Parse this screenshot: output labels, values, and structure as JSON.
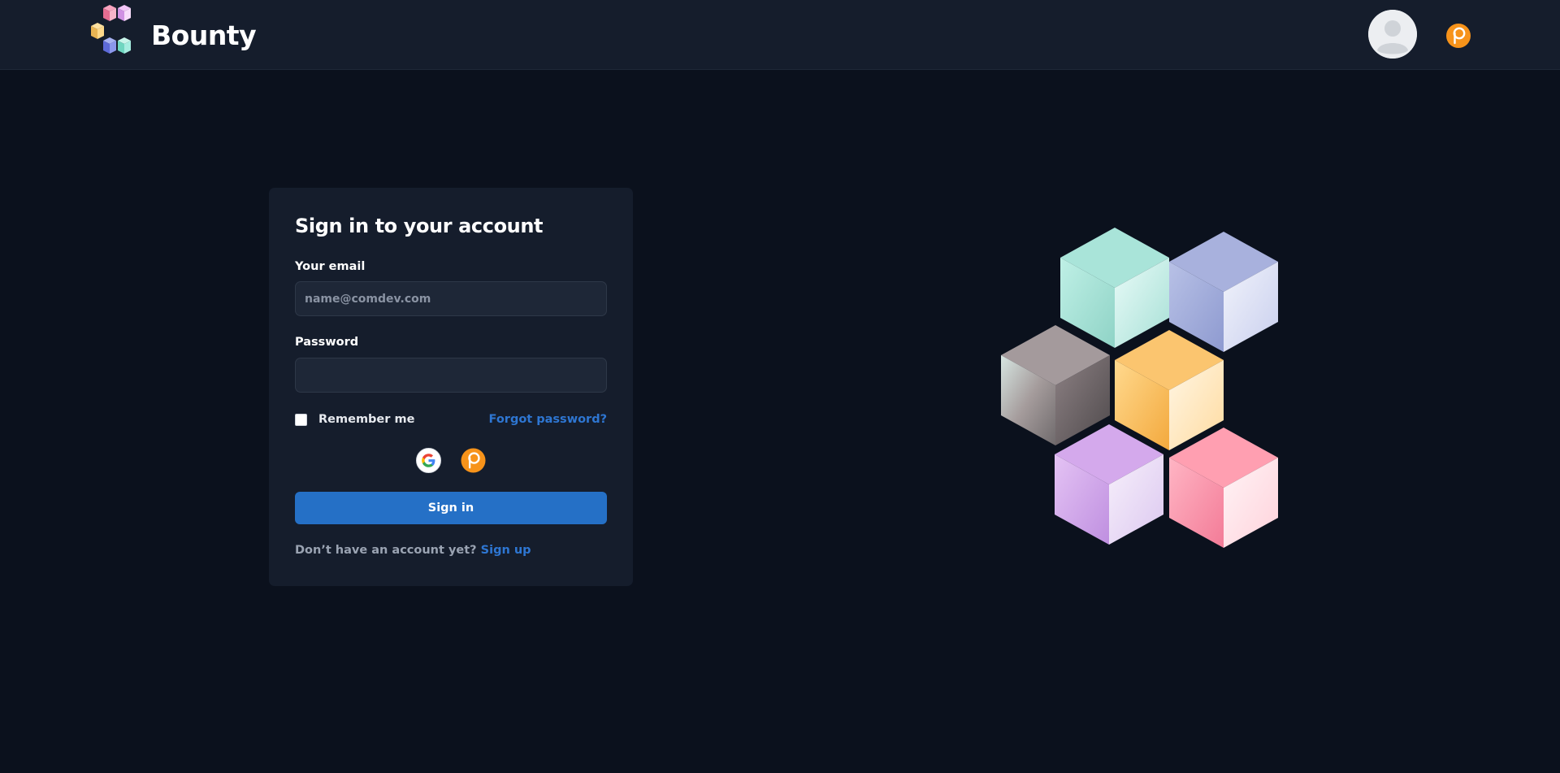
{
  "navbar": {
    "brand_name": "Bounty",
    "logo_icon": "cubes-logo-icon",
    "avatar_icon": "user-avatar-icon",
    "wallet_icon": "wallet-p-icon"
  },
  "signin": {
    "title": "Sign in to your account",
    "email_label": "Your email",
    "email_placeholder": "name@comdev.com",
    "email_value": "",
    "password_label": "Password",
    "password_value": "",
    "remember_label": "Remember me",
    "remember_checked": false,
    "forgot_label": "Forgot password?",
    "social_icons": [
      "google-icon",
      "wallet-p-icon"
    ],
    "submit_label": "Sign in",
    "signup_prompt": "Don’t have an account yet?",
    "signup_label": "Sign up"
  },
  "colors": {
    "page_bg": "#0b111d",
    "navbar_bg": "#151d2c",
    "card_bg": "#151d2c",
    "input_bg": "#1e2737",
    "accent": "#2570c6",
    "link": "#2e76d2",
    "wallet_orange": "#f7931a"
  }
}
